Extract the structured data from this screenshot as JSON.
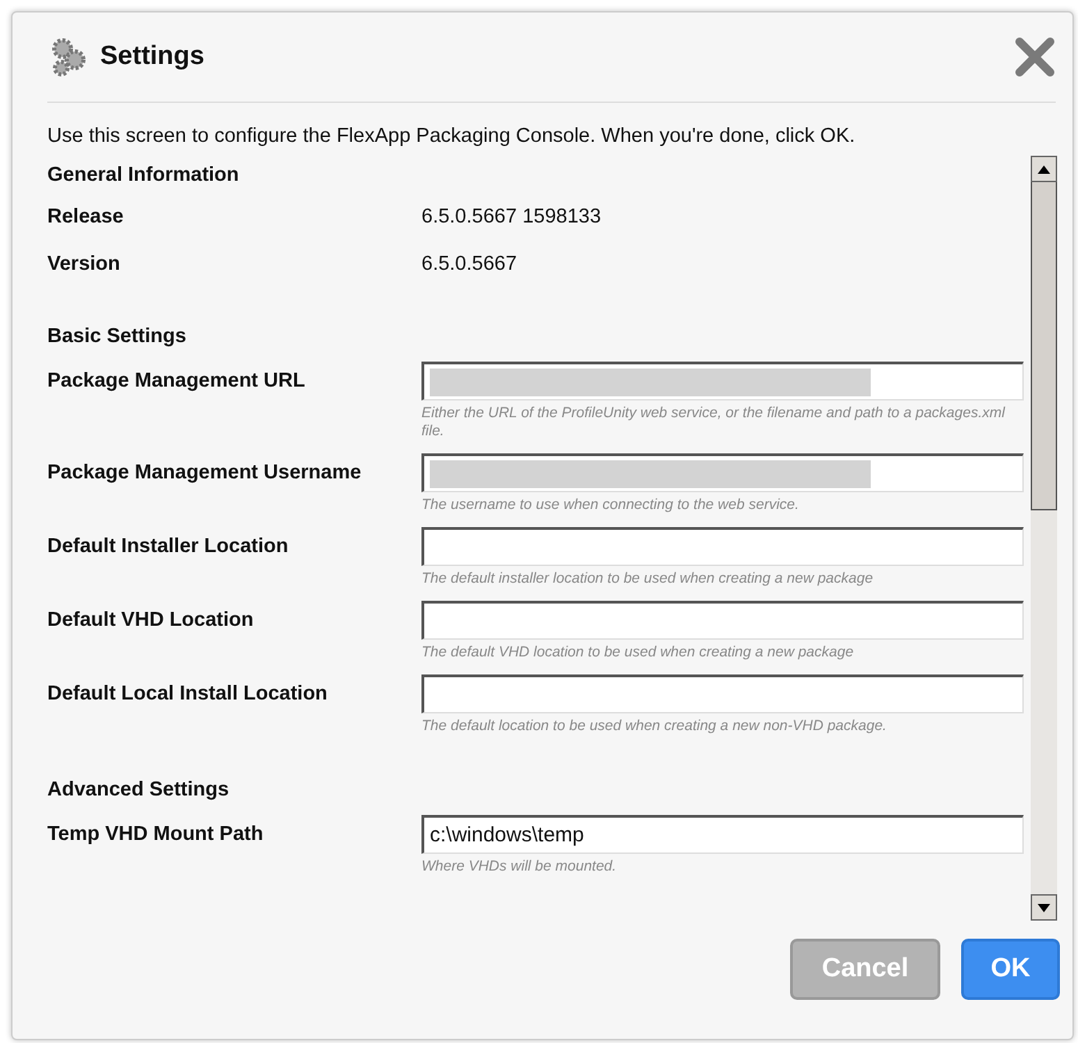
{
  "dialog": {
    "title": "Settings",
    "intro": "Use this screen to configure the FlexApp Packaging Console. When you're done, click OK."
  },
  "sections": [
    {
      "heading": "General Information",
      "rows": [
        {
          "kind": "info",
          "label": "Release",
          "value": "6.5.0.5667 1598133"
        },
        {
          "kind": "info",
          "label": "Version",
          "value": "6.5.0.5667"
        }
      ]
    },
    {
      "heading": "Basic Settings",
      "rows": [
        {
          "kind": "field",
          "label": "Package Management URL",
          "redacted": true,
          "hint": "Either the URL of the ProfileUnity web service, or the filename and path to a packages.xml file."
        },
        {
          "kind": "field",
          "label": "Package Management Username",
          "redacted": true,
          "hint": "The username to use when connecting to the web service."
        },
        {
          "kind": "field",
          "label": "Default Installer Location",
          "redacted": false,
          "hint": "The default installer location to be used when creating a new package"
        },
        {
          "kind": "field",
          "label": "Default VHD Location",
          "redacted": false,
          "hint": "The default VHD location to be used when creating a new package"
        },
        {
          "kind": "field",
          "label": "Default Local Install Location",
          "redacted": false,
          "hint": "The default location to be used when creating a new non-VHD package."
        }
      ]
    },
    {
      "heading": "Advanced Settings",
      "rows": [
        {
          "kind": "field",
          "label": "Temp VHD Mount Path",
          "redacted": false,
          "value": "c:\\windows\\temp",
          "hint": "Where VHDs will be mounted."
        }
      ]
    }
  ],
  "buttons": [
    {
      "label": "Cancel",
      "disabled": true
    },
    {
      "label": "OK",
      "disabled": false
    }
  ]
}
